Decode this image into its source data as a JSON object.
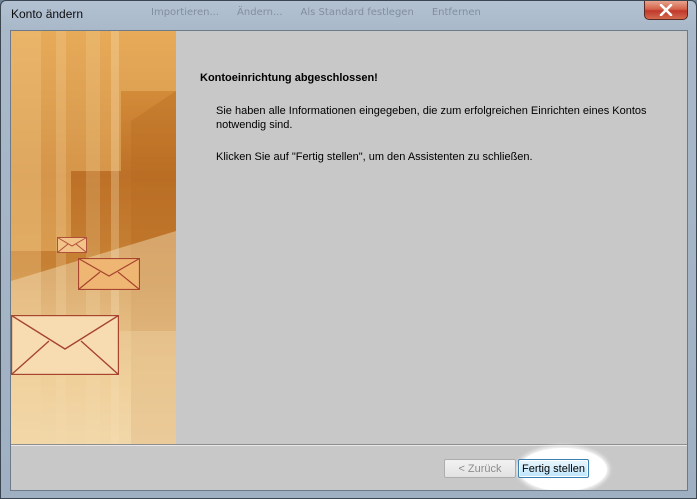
{
  "window": {
    "title": "Konto ändern"
  },
  "background_strip": [
    "Importieren...",
    "Ändern...",
    "Als Standard festlegen",
    "Entfernen"
  ],
  "page": {
    "heading": "Kontoeinrichtung abgeschlossen!",
    "paragraph1": "Sie haben alle Informationen eingegeben, die zum erfolgreichen Einrichten eines Kontos notwendig sind.",
    "paragraph2": "Klicken Sie auf \"Fertig stellen\", um den Assistenten zu schließen."
  },
  "footer": {
    "back_label": "< Zurück",
    "finish_label": "Fertig stellen"
  },
  "colors": {
    "accent_button_border": "#3c7fb1",
    "close_button": "#c0392b",
    "art_orange": "#e8a44a"
  },
  "icons": {
    "close": "close-icon",
    "envelopes": "envelope-icon"
  }
}
